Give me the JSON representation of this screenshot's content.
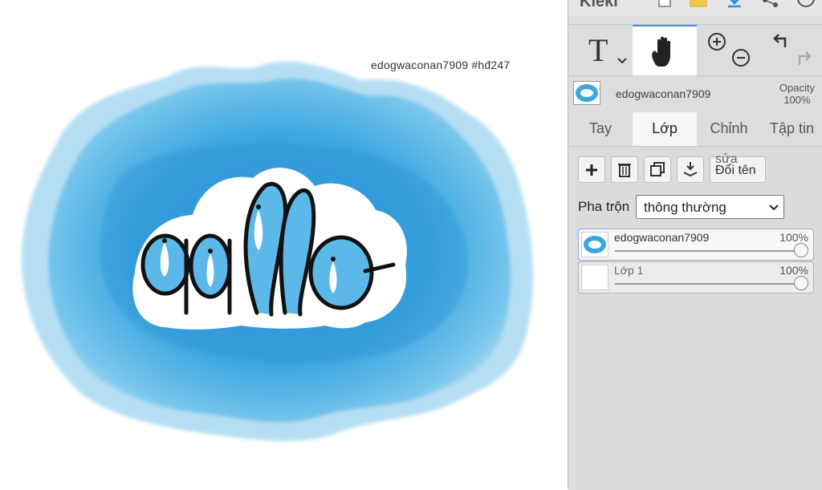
{
  "app": {
    "name": "Kleki"
  },
  "canvas": {
    "watermark": "edogwaconan7909   #hđ247",
    "artwork_text": "alo"
  },
  "toolbar": {
    "brush_tool": "brush-tool",
    "text_tool": "T",
    "hand_tool": "hand-tool",
    "zoom_in": "zoom-in",
    "zoom_out": "zoom-out",
    "undo": "undo",
    "redo": "redo"
  },
  "layer_info": {
    "name": "edogwaconan7909",
    "opacity_label": "Opacity",
    "opacity_value": "100%"
  },
  "tabs": [
    {
      "label": "Tay",
      "active": false
    },
    {
      "label": "Lớp",
      "active": true
    },
    {
      "label": "Chỉnh",
      "active": false
    },
    {
      "label": "Tập tin",
      "active": false
    }
  ],
  "layer_tools": {
    "add": "add-layer",
    "delete": "delete-layer",
    "duplicate": "duplicate-layer",
    "merge": "merge-down",
    "rename_top": "sửa",
    "rename": "Đổi tên"
  },
  "blend": {
    "label": "Pha trộn",
    "value": "thông thường"
  },
  "layers": [
    {
      "name": "edogwaconan7909",
      "opacity": "100%",
      "opacity_value": 1.0,
      "selected": true
    },
    {
      "name": "Lớp 1",
      "opacity": "100%",
      "opacity_value": 1.0,
      "selected": false
    }
  ],
  "colors": {
    "accent": "#4d8fdc",
    "blot_blue": "#3aa3dd",
    "letter_fill": "#5bb8e9",
    "panel_bg": "#dddddd"
  }
}
